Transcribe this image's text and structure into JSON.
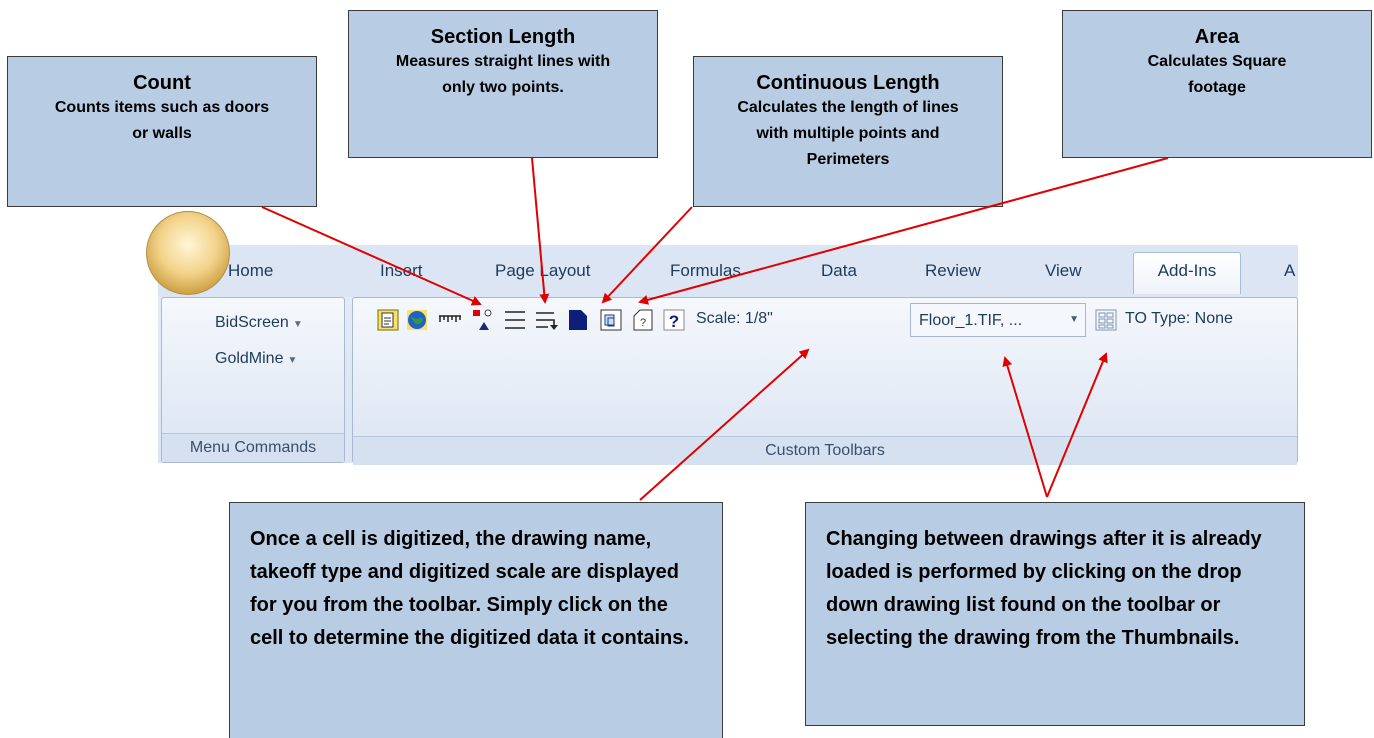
{
  "callouts": {
    "count": {
      "title": "Count",
      "desc": "Counts items such as doors or walls"
    },
    "section_length": {
      "title": "Section Length",
      "desc": "Measures straight lines with only two points."
    },
    "continuous_length": {
      "title": "Continuous Length",
      "desc": "Calculates the length of lines with multiple points and Perimeters"
    },
    "area": {
      "title": "Area",
      "desc": "Calculates Square footage"
    },
    "digitized_info": "Once a cell is digitized, the drawing name, takeoff type and digitized scale are displayed for you from the toolbar. Simply click on the cell to determine the digitized data it contains.",
    "change_drawings": "Changing between drawings after it is already loaded is performed by clicking on the drop down drawing list found on the toolbar or selecting the drawing from the Thumbnails."
  },
  "ribbon": {
    "tabs": [
      "Home",
      "Insert",
      "Page Layout",
      "Formulas",
      "Data",
      "Review",
      "View",
      "Add-Ins",
      "A"
    ],
    "active_tab": "Add-Ins",
    "menu_commands": {
      "items": [
        "BidScreen",
        "GoldMine"
      ],
      "label": "Menu Commands"
    },
    "custom_toolbars": {
      "label": "Custom Toolbars",
      "icons": [
        "open-drawing-icon",
        "globe-icon",
        "ruler-icon",
        "count-icon",
        "section-length-icon",
        "continuous-length-icon",
        "area-icon",
        "thumbnail-icon",
        "new-document-icon",
        "help-icon"
      ],
      "scale_text": "Scale: 1/8\"",
      "drawing_value": "Floor_1.TIF, ...",
      "to_type_text": "TO Type: None"
    }
  },
  "colors": {
    "callout_fill": "#b8cce4",
    "arrow": "#e00000",
    "ribbon_bg": "#dbe5f3"
  }
}
